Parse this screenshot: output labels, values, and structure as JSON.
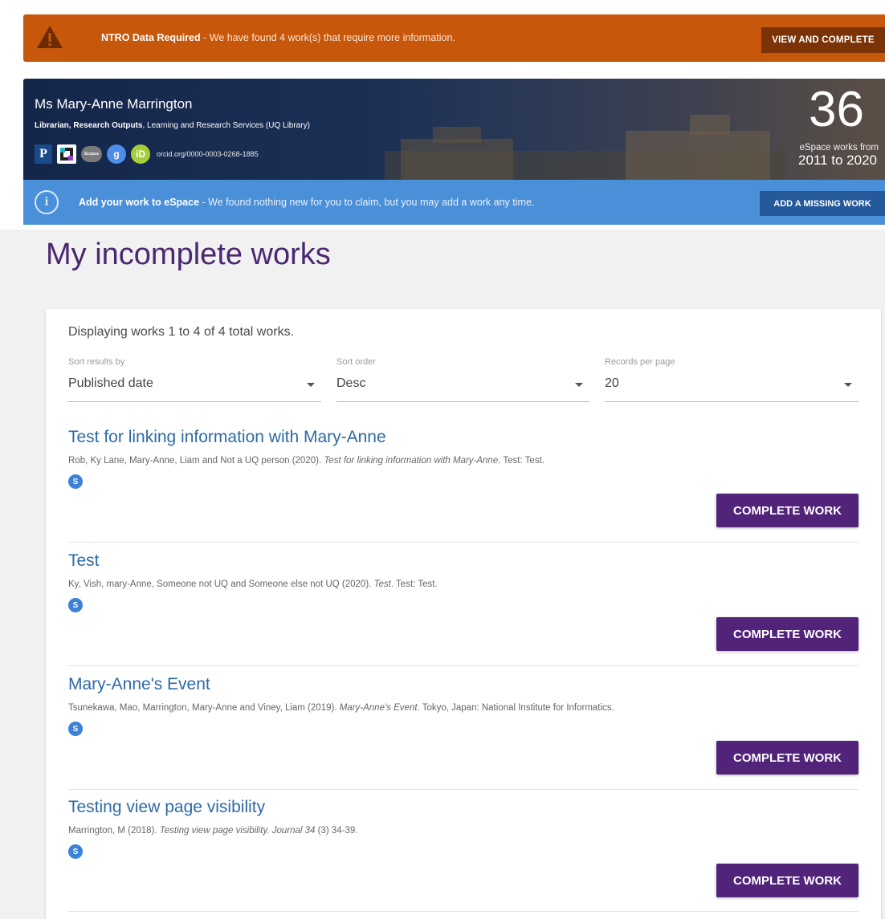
{
  "ntro": {
    "title": "NTRO Data Required",
    "message": " - We have found 4 work(s) that require more information.",
    "button": "VIEW AND COMPLETE",
    "color": "#c6570b"
  },
  "profile": {
    "name": "Ms Mary-Anne Marrington",
    "role_bold": "Librarian, Research Outputs",
    "role_rest": ", Learning and Research Services (UQ Library)",
    "icons": [
      "publons-icon",
      "pure-icon",
      "scopus-icon",
      "google-scholar-icon",
      "orcid-icon"
    ],
    "orcid_url": "orcid.org/0000-0003-0268-1885",
    "works_count": "36",
    "works_label": "eSpace works from",
    "works_years": "2011 to 2020"
  },
  "info": {
    "title": "Add your work to eSpace",
    "message": " - We found nothing new for you to claim, but you may add a work any time.",
    "button": "ADD A MISSING WORK",
    "color": "#4a90d9"
  },
  "page": {
    "title": "My incomplete works"
  },
  "list": {
    "displaying": "Displaying works 1 to 4 of 4 total works.",
    "sort_by": {
      "label": "Sort results by",
      "value": "Published date"
    },
    "sort_order": {
      "label": "Sort order",
      "value": "Desc"
    },
    "per_page": {
      "label": "Records per page",
      "value": "20"
    },
    "complete_button": "COMPLETE WORK",
    "works": [
      {
        "title": "Test for linking information with Mary-Anne",
        "authors": "Rob, Ky Lane, Mary-Anne, Liam and Not a UQ person (2020). ",
        "cite_title": "Test for linking information with Mary-Anne",
        "cite_rest": ". Test: Test."
      },
      {
        "title": "Test",
        "authors": "Ky, Vish, mary-Anne, Someone not UQ and Someone else not UQ (2020). ",
        "cite_title": "Test",
        "cite_rest": ". Test: Test."
      },
      {
        "title": "Mary-Anne's Event",
        "authors": "Tsunekawa, Mao, Marrington, Mary-Anne and Viney, Liam (2019). ",
        "cite_title": "Mary-Anne's Event",
        "cite_rest": ". Tokyo, Japan: National Institute for Informatics."
      },
      {
        "title": "Testing view page visibility",
        "authors": "Marrington, M (2018). ",
        "cite_title": "Testing view page visibility. Journal 34",
        "cite_rest": " (3) 34-39."
      }
    ]
  },
  "colors": {
    "accent": "#51247a",
    "title_purple": "#4b2770",
    "link_blue": "#2d6aa6"
  }
}
